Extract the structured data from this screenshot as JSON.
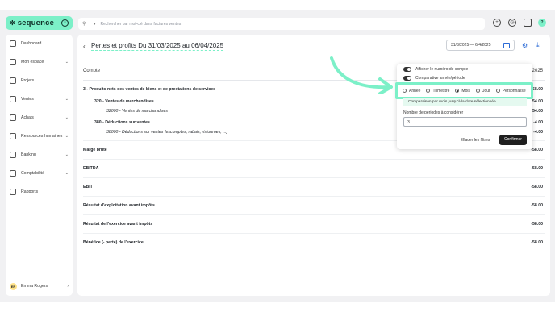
{
  "brand": {
    "name": "sequence",
    "pin": "☆"
  },
  "search": {
    "placeholder": "Rechercher par mot-clé dans factures ventes",
    "caret": "▾"
  },
  "topbar": {
    "help": "?"
  },
  "sidebar": {
    "items": [
      {
        "label": "Dashboard",
        "chevron": ""
      },
      {
        "label": "Mon espace",
        "chevron": "⌄"
      },
      {
        "label": "Projets",
        "chevron": ""
      },
      {
        "label": "Ventes",
        "chevron": "⌄"
      },
      {
        "label": "Achats",
        "chevron": "⌄"
      },
      {
        "label": "Ressources humaines",
        "chevron": "⌄"
      },
      {
        "label": "Banking",
        "chevron": "⌄"
      },
      {
        "label": "Comptabilité",
        "chevron": "⌄"
      },
      {
        "label": "Rapports",
        "chevron": ""
      }
    ],
    "user": {
      "initials": "ER",
      "name": "Emma Rogers",
      "chevron": "›"
    }
  },
  "main": {
    "title": "Pertes et profits Du 31/03/2025 au 06/04/2025",
    "date_range": "31/3/2025 — 6/4/2025",
    "column_header": "Compte",
    "column_year": "/2025",
    "rows": [
      {
        "label": "3 - Produits nets des ventes de biens et de prestations de services",
        "value": "-58.00"
      },
      {
        "label": "320 - Ventes de marchandises",
        "value": "-54.00"
      },
      {
        "label": "32000 - Ventes de marchandises",
        "value": "-54.00"
      },
      {
        "label": "380 - Déductions sur ventes",
        "value": "-4.00"
      },
      {
        "label": "38000 - Déductions sur ventes (escomptes, rabais, ristournes, ...)",
        "value": "-4.00"
      },
      {
        "label": "Marge brute",
        "value": "-58.00"
      },
      {
        "label": "EBITDA",
        "value": "-58.00"
      },
      {
        "label": "EBIT",
        "value": "-58.00"
      },
      {
        "label": "Résultat d'exploitation avant impôts",
        "value": "-58.00"
      },
      {
        "label": "Résultat de l'exercice avant impôts",
        "value": "-58.00"
      },
      {
        "label": "Bénéfice (- perte) de l'exercice",
        "value": "-58.00"
      }
    ]
  },
  "filters": {
    "show_account_number": "Afficher le numéro de compte",
    "comparative": "Comparative année/période",
    "periods": [
      "Année",
      "Trimestre",
      "Mois",
      "Jour",
      "Personnalisé"
    ],
    "selected_period": "Mois",
    "hint": "Comparaison par mois jusqu'à la date sélectionnée",
    "num_periods_label": "Nombre de périodes à considérer",
    "num_periods_value": "3",
    "clear_label": "Effacer les filtres",
    "confirm_label": "Confirmer"
  },
  "colors": {
    "accent": "#7cf0c8",
    "link": "#2c6bd6",
    "dark": "#1f1f1f"
  }
}
